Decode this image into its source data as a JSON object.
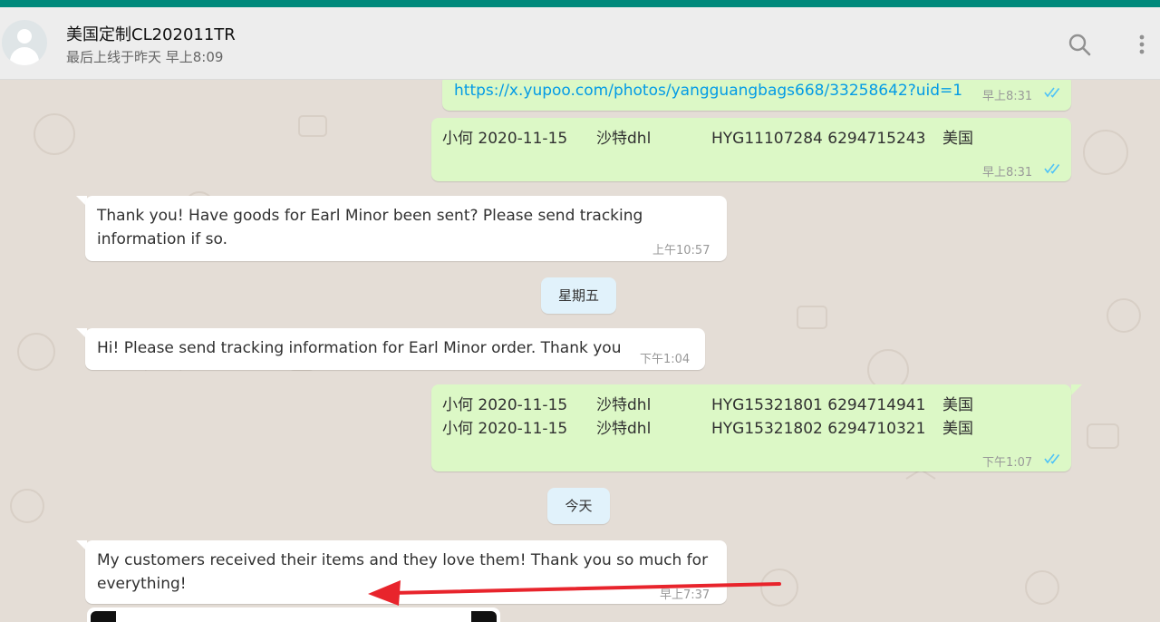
{
  "header": {
    "contact_name": "美国定制CL202011TR",
    "last_seen": "最后上线于昨天 早上8:09"
  },
  "icons": {
    "avatar": "default-avatar-icon",
    "search": "search-icon",
    "menu": "more-vertical-icon",
    "read": "double-check-icon"
  },
  "colors": {
    "accent": "#00897b",
    "incoming_bubble": "#ffffff",
    "outgoing_bubble": "#dcf8c6",
    "link": "#039be5",
    "read_ticks": "#4fc3f7",
    "day_separator": "#e1f2fb",
    "annotation_arrow": "#e8242c"
  },
  "messages": [
    {
      "direction": "out",
      "link": "https://x.yupoo.com/photos/yangguangbags668/33258642?uid=1",
      "time": "早上8:31"
    },
    {
      "direction": "out",
      "rows": [
        [
          "小何 2020-11-15",
          "沙特dhl",
          "HYG11107284 6294715243",
          "美国"
        ]
      ],
      "time": "早上8:31"
    },
    {
      "direction": "in",
      "lines": [
        "Thank you! Have goods for Earl Minor been sent? Please send tracking",
        "information if so."
      ],
      "time": "上午10:57"
    },
    {
      "direction": "in",
      "lines": [
        "Hi! Please send tracking information for Earl Minor order. Thank you"
      ],
      "time": "下午1:04"
    },
    {
      "direction": "out",
      "rows": [
        [
          "小何 2020-11-15",
          "沙特dhl",
          "HYG15321801 6294714941",
          "美国"
        ],
        [
          "小何 2020-11-15",
          "沙特dhl",
          "HYG15321802 6294710321",
          "美国"
        ]
      ],
      "time": "下午1:07"
    },
    {
      "direction": "in",
      "lines": [
        "My customers received their items and they love them! Thank you so much for",
        "everything!"
      ],
      "time": "早上7:37"
    }
  ],
  "day_separators": [
    "星期五",
    "今天"
  ]
}
